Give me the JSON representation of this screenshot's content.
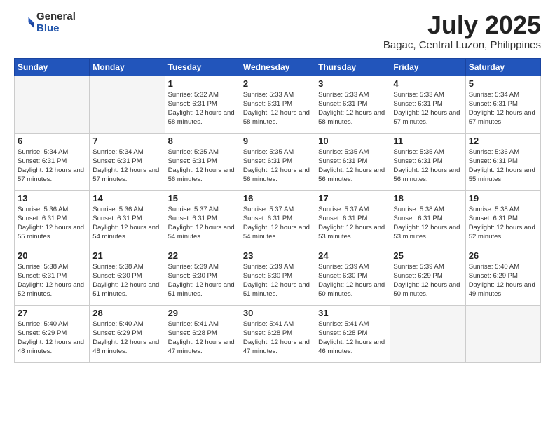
{
  "logo": {
    "general": "General",
    "blue": "Blue"
  },
  "title": "July 2025",
  "subtitle": "Bagac, Central Luzon, Philippines",
  "weekdays": [
    "Sunday",
    "Monday",
    "Tuesday",
    "Wednesday",
    "Thursday",
    "Friday",
    "Saturday"
  ],
  "weeks": [
    [
      {
        "day": "",
        "empty": true
      },
      {
        "day": "",
        "empty": true
      },
      {
        "day": "1",
        "sunrise": "5:32 AM",
        "sunset": "6:31 PM",
        "daylight": "12 hours and 58 minutes."
      },
      {
        "day": "2",
        "sunrise": "5:33 AM",
        "sunset": "6:31 PM",
        "daylight": "12 hours and 58 minutes."
      },
      {
        "day": "3",
        "sunrise": "5:33 AM",
        "sunset": "6:31 PM",
        "daylight": "12 hours and 58 minutes."
      },
      {
        "day": "4",
        "sunrise": "5:33 AM",
        "sunset": "6:31 PM",
        "daylight": "12 hours and 57 minutes."
      },
      {
        "day": "5",
        "sunrise": "5:34 AM",
        "sunset": "6:31 PM",
        "daylight": "12 hours and 57 minutes."
      }
    ],
    [
      {
        "day": "6",
        "sunrise": "5:34 AM",
        "sunset": "6:31 PM",
        "daylight": "12 hours and 57 minutes."
      },
      {
        "day": "7",
        "sunrise": "5:34 AM",
        "sunset": "6:31 PM",
        "daylight": "12 hours and 57 minutes."
      },
      {
        "day": "8",
        "sunrise": "5:35 AM",
        "sunset": "6:31 PM",
        "daylight": "12 hours and 56 minutes."
      },
      {
        "day": "9",
        "sunrise": "5:35 AM",
        "sunset": "6:31 PM",
        "daylight": "12 hours and 56 minutes."
      },
      {
        "day": "10",
        "sunrise": "5:35 AM",
        "sunset": "6:31 PM",
        "daylight": "12 hours and 56 minutes."
      },
      {
        "day": "11",
        "sunrise": "5:35 AM",
        "sunset": "6:31 PM",
        "daylight": "12 hours and 56 minutes."
      },
      {
        "day": "12",
        "sunrise": "5:36 AM",
        "sunset": "6:31 PM",
        "daylight": "12 hours and 55 minutes."
      }
    ],
    [
      {
        "day": "13",
        "sunrise": "5:36 AM",
        "sunset": "6:31 PM",
        "daylight": "12 hours and 55 minutes."
      },
      {
        "day": "14",
        "sunrise": "5:36 AM",
        "sunset": "6:31 PM",
        "daylight": "12 hours and 54 minutes."
      },
      {
        "day": "15",
        "sunrise": "5:37 AM",
        "sunset": "6:31 PM",
        "daylight": "12 hours and 54 minutes."
      },
      {
        "day": "16",
        "sunrise": "5:37 AM",
        "sunset": "6:31 PM",
        "daylight": "12 hours and 54 minutes."
      },
      {
        "day": "17",
        "sunrise": "5:37 AM",
        "sunset": "6:31 PM",
        "daylight": "12 hours and 53 minutes."
      },
      {
        "day": "18",
        "sunrise": "5:38 AM",
        "sunset": "6:31 PM",
        "daylight": "12 hours and 53 minutes."
      },
      {
        "day": "19",
        "sunrise": "5:38 AM",
        "sunset": "6:31 PM",
        "daylight": "12 hours and 52 minutes."
      }
    ],
    [
      {
        "day": "20",
        "sunrise": "5:38 AM",
        "sunset": "6:31 PM",
        "daylight": "12 hours and 52 minutes."
      },
      {
        "day": "21",
        "sunrise": "5:38 AM",
        "sunset": "6:30 PM",
        "daylight": "12 hours and 51 minutes."
      },
      {
        "day": "22",
        "sunrise": "5:39 AM",
        "sunset": "6:30 PM",
        "daylight": "12 hours and 51 minutes."
      },
      {
        "day": "23",
        "sunrise": "5:39 AM",
        "sunset": "6:30 PM",
        "daylight": "12 hours and 51 minutes."
      },
      {
        "day": "24",
        "sunrise": "5:39 AM",
        "sunset": "6:30 PM",
        "daylight": "12 hours and 50 minutes."
      },
      {
        "day": "25",
        "sunrise": "5:39 AM",
        "sunset": "6:29 PM",
        "daylight": "12 hours and 50 minutes."
      },
      {
        "day": "26",
        "sunrise": "5:40 AM",
        "sunset": "6:29 PM",
        "daylight": "12 hours and 49 minutes."
      }
    ],
    [
      {
        "day": "27",
        "sunrise": "5:40 AM",
        "sunset": "6:29 PM",
        "daylight": "12 hours and 48 minutes."
      },
      {
        "day": "28",
        "sunrise": "5:40 AM",
        "sunset": "6:29 PM",
        "daylight": "12 hours and 48 minutes."
      },
      {
        "day": "29",
        "sunrise": "5:41 AM",
        "sunset": "6:28 PM",
        "daylight": "12 hours and 47 minutes."
      },
      {
        "day": "30",
        "sunrise": "5:41 AM",
        "sunset": "6:28 PM",
        "daylight": "12 hours and 47 minutes."
      },
      {
        "day": "31",
        "sunrise": "5:41 AM",
        "sunset": "6:28 PM",
        "daylight": "12 hours and 46 minutes."
      },
      {
        "day": "",
        "empty": true
      },
      {
        "day": "",
        "empty": true
      }
    ]
  ]
}
